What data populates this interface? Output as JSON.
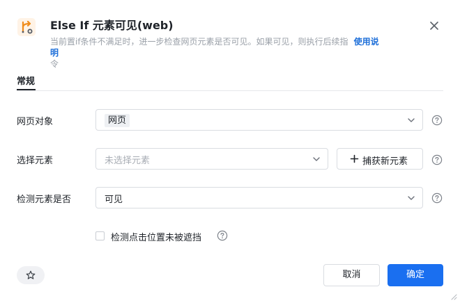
{
  "header": {
    "title": "Else If 元素可见(web)",
    "description_line1": "当前置if条件不满足时，进一步检查网页元素是否可见。如果可见，则执行后续指",
    "description_line2": "令",
    "help_link": "使用说明",
    "icon": "branch-icon",
    "close_icon": "close-icon"
  },
  "tabs": [
    {
      "label": "常规",
      "active": true
    }
  ],
  "form": {
    "web_object": {
      "label": "网页对象",
      "value": "网页"
    },
    "select_element": {
      "label": "选择元素",
      "placeholder": "未选择元素",
      "capture_button": "捕获新元素"
    },
    "check_visibility": {
      "label": "检测元素是否",
      "value": "可见"
    },
    "check_occlusion": {
      "label": "检测点击位置未被遮挡",
      "checked": false
    }
  },
  "footer": {
    "favorite_icon": "star-icon",
    "cancel_label": "取消",
    "ok_label": "确定"
  },
  "colors": {
    "primary": "#1a6ff0",
    "link": "#1e6fd9",
    "icon_accent": "#f08c1a"
  }
}
